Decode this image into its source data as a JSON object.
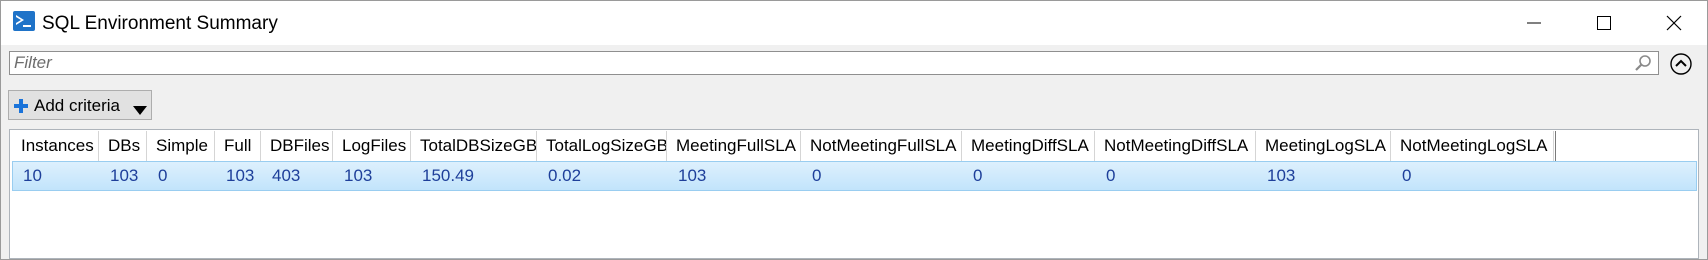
{
  "window": {
    "title": "SQL Environment Summary",
    "icon": "powershell-icon"
  },
  "filter": {
    "placeholder": "Filter",
    "value": ""
  },
  "toolbar": {
    "add_criteria_label": "Add criteria"
  },
  "table": {
    "columns": [
      "Instances",
      "DBs",
      "Simple",
      "Full",
      "DBFiles",
      "LogFiles",
      "TotalDBSizeGB",
      "TotalLogSizeGB",
      "MeetingFullSLA",
      "NotMeetingFullSLA",
      "MeetingDiffSLA",
      "NotMeetingDiffSLA",
      "MeetingLogSLA",
      "NotMeetingLogSLA"
    ],
    "rows": [
      [
        "10",
        "103",
        "0",
        "103",
        "403",
        "103",
        "150.49",
        "0.02",
        "103",
        "0",
        "0",
        "0",
        "103",
        "0"
      ]
    ]
  },
  "colors": {
    "selected_row": "#c9e7fb",
    "cell_text": "#1e3f9a",
    "accent_icon": "#1a73d9"
  }
}
